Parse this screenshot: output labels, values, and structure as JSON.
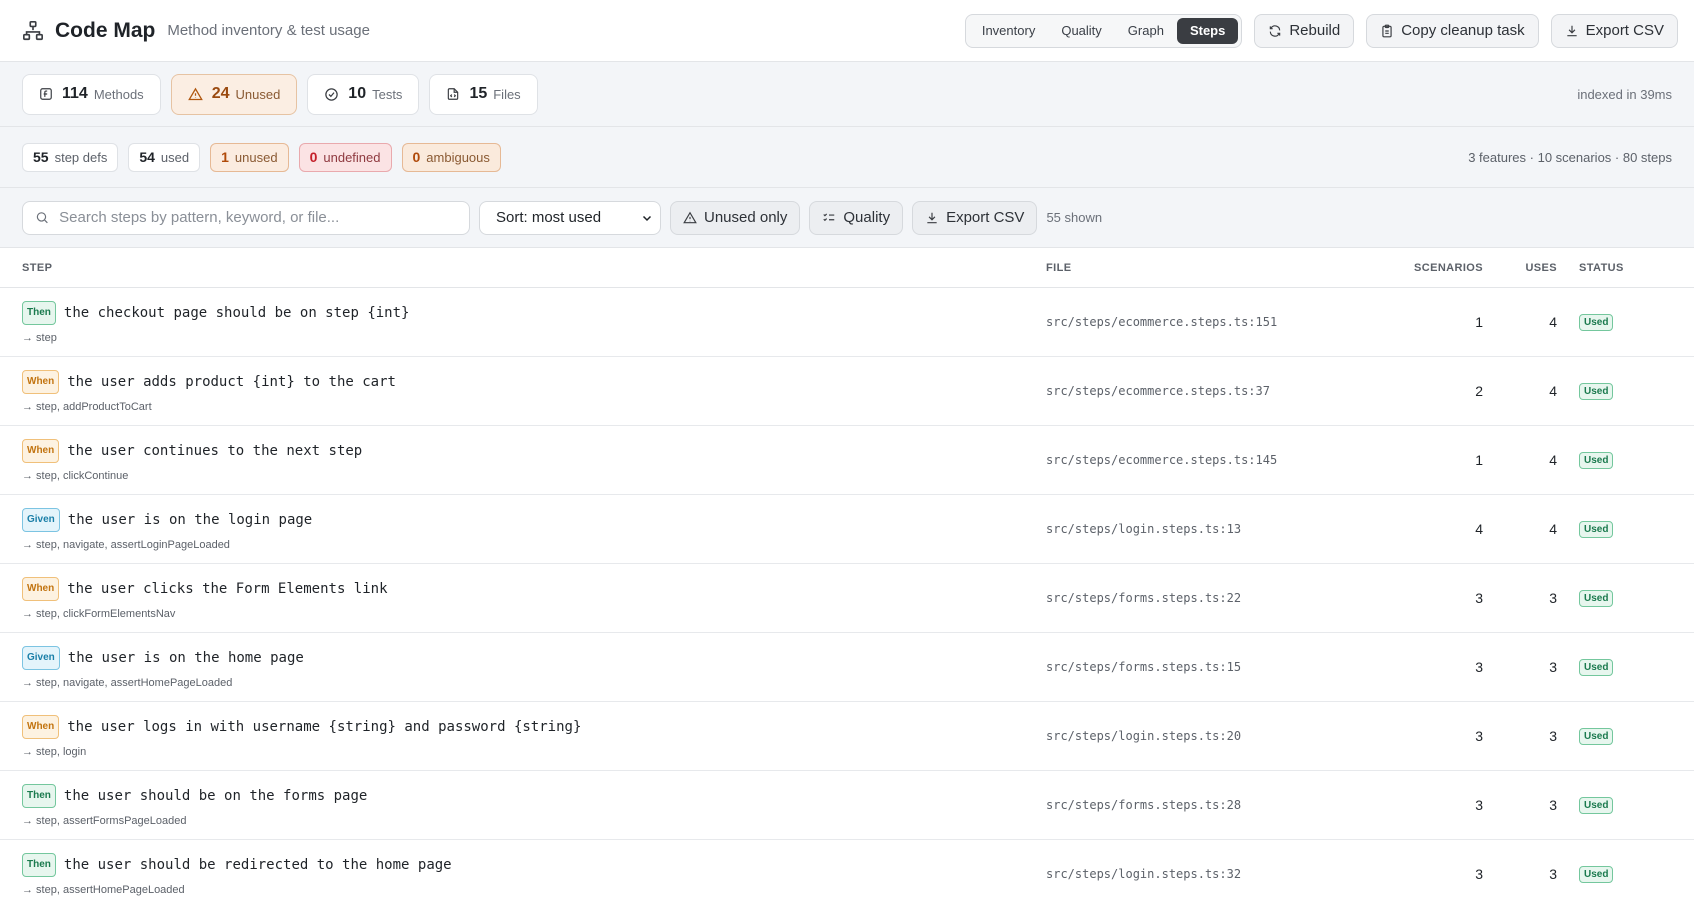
{
  "header": {
    "title": "Code Map",
    "subtitle": "Method inventory & test usage",
    "tabs": [
      {
        "label": "Inventory",
        "active": false
      },
      {
        "label": "Quality",
        "active": false
      },
      {
        "label": "Graph",
        "active": false
      },
      {
        "label": "Steps",
        "active": true
      }
    ],
    "buttons": {
      "rebuild": "Rebuild",
      "copy_cleanup": "Copy cleanup task",
      "export_csv": "Export CSV"
    }
  },
  "stats": {
    "methods": {
      "value": "114",
      "label": "Methods"
    },
    "unused": {
      "value": "24",
      "label": "Unused"
    },
    "tests": {
      "value": "10",
      "label": "Tests"
    },
    "files": {
      "value": "15",
      "label": "Files"
    },
    "indexed": "indexed in 39ms"
  },
  "steps_summary": {
    "step_defs": {
      "value": "55",
      "label": "step defs"
    },
    "used": {
      "value": "54",
      "label": "used"
    },
    "unused": {
      "value": "1",
      "label": "unused"
    },
    "undefined": {
      "value": "0",
      "label": "undefined"
    },
    "ambiguous": {
      "value": "0",
      "label": "ambiguous"
    },
    "totals": "3 features · 10 scenarios · 80 steps"
  },
  "toolbar": {
    "search_placeholder": "Search steps by pattern, keyword, or file...",
    "sort_value": "Sort: most used",
    "unused_only": "Unused only",
    "quality": "Quality",
    "export_csv": "Export CSV",
    "shown": "55 shown"
  },
  "table": {
    "headers": {
      "step": "STEP",
      "file": "FILE",
      "scenarios": "SCENARIOS",
      "uses": "USES",
      "status": "STATUS"
    },
    "rows": [
      {
        "keyword": "Then",
        "pattern": "the checkout page should be on step {int}",
        "calls": "→ step",
        "file": "src/steps/ecommerce.steps.ts:151",
        "scenarios": "1",
        "uses": "4",
        "status": "Used"
      },
      {
        "keyword": "When",
        "pattern": "the user adds product {int} to the cart",
        "calls": "→ step, addProductToCart",
        "file": "src/steps/ecommerce.steps.ts:37",
        "scenarios": "2",
        "uses": "4",
        "status": "Used"
      },
      {
        "keyword": "When",
        "pattern": "the user continues to the next step",
        "calls": "→ step, clickContinue",
        "file": "src/steps/ecommerce.steps.ts:145",
        "scenarios": "1",
        "uses": "4",
        "status": "Used"
      },
      {
        "keyword": "Given",
        "pattern": "the user is on the login page",
        "calls": "→ step, navigate, assertLoginPageLoaded",
        "file": "src/steps/login.steps.ts:13",
        "scenarios": "4",
        "uses": "4",
        "status": "Used"
      },
      {
        "keyword": "When",
        "pattern": "the user clicks the Form Elements link",
        "calls": "→ step, clickFormElementsNav",
        "file": "src/steps/forms.steps.ts:22",
        "scenarios": "3",
        "uses": "3",
        "status": "Used"
      },
      {
        "keyword": "Given",
        "pattern": "the user is on the home page",
        "calls": "→ step, navigate, assertHomePageLoaded",
        "file": "src/steps/forms.steps.ts:15",
        "scenarios": "3",
        "uses": "3",
        "status": "Used"
      },
      {
        "keyword": "When",
        "pattern": "the user logs in with username {string} and password {string}",
        "calls": "→ step, login",
        "file": "src/steps/login.steps.ts:20",
        "scenarios": "3",
        "uses": "3",
        "status": "Used"
      },
      {
        "keyword": "Then",
        "pattern": "the user should be on the forms page",
        "calls": "→ step, assertFormsPageLoaded",
        "file": "src/steps/forms.steps.ts:28",
        "scenarios": "3",
        "uses": "3",
        "status": "Used"
      },
      {
        "keyword": "Then",
        "pattern": "the user should be redirected to the home page",
        "calls": "→ step, assertHomePageLoaded",
        "file": "src/steps/login.steps.ts:32",
        "scenarios": "3",
        "uses": "3",
        "status": "Used"
      }
    ]
  }
}
